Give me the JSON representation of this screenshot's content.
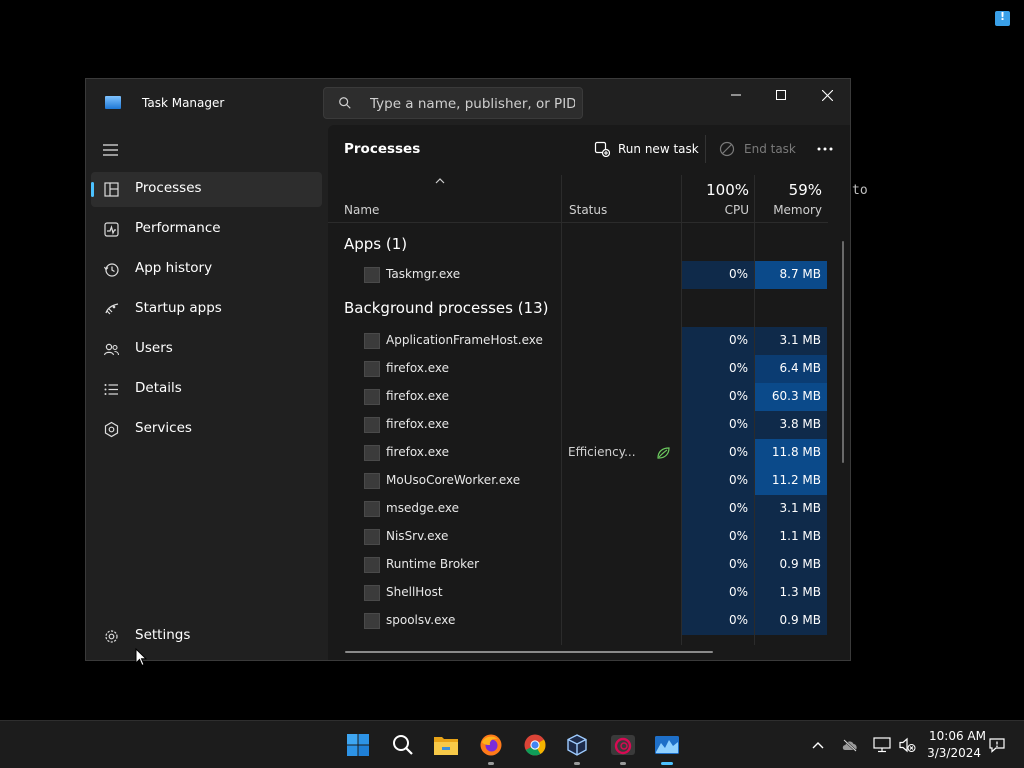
{
  "desktop": {
    "terminal_fragment": "to"
  },
  "window": {
    "title": "Task Manager",
    "search_placeholder": "Type a name, publisher, or PID..."
  },
  "sidebar": {
    "items": [
      {
        "label": "Processes",
        "icon": "processes-icon",
        "active": true
      },
      {
        "label": "Performance",
        "icon": "performance-icon"
      },
      {
        "label": "App history",
        "icon": "app-history-icon"
      },
      {
        "label": "Startup apps",
        "icon": "startup-apps-icon"
      },
      {
        "label": "Users",
        "icon": "users-icon"
      },
      {
        "label": "Details",
        "icon": "details-icon"
      },
      {
        "label": "Services",
        "icon": "services-icon"
      }
    ],
    "settings_label": "Settings"
  },
  "toolbar": {
    "page_title": "Processes",
    "run_new_task": "Run new task",
    "end_task": "End task"
  },
  "table": {
    "columns": {
      "name": "Name",
      "status": "Status",
      "cpu_total": "100%",
      "cpu": "CPU",
      "memory_total": "59%",
      "memory": "Memory"
    },
    "apps_group": "Apps (1)",
    "apps": [
      {
        "name": "Taskmgr.exe",
        "status": "",
        "cpu": "0%",
        "memory": "8.7 MB",
        "mem_color": "#0b4a8a"
      }
    ],
    "background_group": "Background processes (13)",
    "background": [
      {
        "name": "ApplicationFrameHost.exe",
        "status": "",
        "cpu": "0%",
        "memory": "3.1 MB",
        "mem_color": "#0f2a4a"
      },
      {
        "name": "firefox.exe",
        "status": "",
        "cpu": "0%",
        "memory": "6.4 MB",
        "mem_color": "#0b3c72"
      },
      {
        "name": "firefox.exe",
        "status": "",
        "cpu": "0%",
        "memory": "60.3 MB",
        "mem_color": "#0b4a8a"
      },
      {
        "name": "firefox.exe",
        "status": "",
        "cpu": "0%",
        "memory": "3.8 MB",
        "mem_color": "#0f2a4a"
      },
      {
        "name": "firefox.exe",
        "status": "Efficiency...",
        "cpu": "0%",
        "memory": "11.8 MB",
        "mem_color": "#0b4a8a",
        "efficiency": true
      },
      {
        "name": "MoUsoCoreWorker.exe",
        "status": "",
        "cpu": "0%",
        "memory": "11.2 MB",
        "mem_color": "#0b4a8a"
      },
      {
        "name": "msedge.exe",
        "status": "",
        "cpu": "0%",
        "memory": "3.1 MB",
        "mem_color": "#0f2a4a"
      },
      {
        "name": "NisSrv.exe",
        "status": "",
        "cpu": "0%",
        "memory": "1.1 MB",
        "mem_color": "#0f2a4a"
      },
      {
        "name": "Runtime Broker",
        "status": "",
        "cpu": "0%",
        "memory": "0.9 MB",
        "mem_color": "#0f2a4a"
      },
      {
        "name": "ShellHost",
        "status": "",
        "cpu": "0%",
        "memory": "1.3 MB",
        "mem_color": "#0f2a4a"
      },
      {
        "name": "spoolsv.exe",
        "status": "",
        "cpu": "0%",
        "memory": "0.9 MB",
        "mem_color": "#0f2a4a"
      }
    ]
  },
  "taskbar": {
    "apps": [
      "windows-start-icon",
      "search-icon",
      "file-explorer-icon",
      "firefox-icon",
      "chrome-icon",
      "virtualbox-icon",
      "debian-terminal-icon",
      "task-manager-icon"
    ],
    "time": "10:06 AM",
    "date": "3/3/2024"
  },
  "colors": {
    "accent": "#4cc2ff",
    "heat_low": "#0f2a4a",
    "heat_high": "#0b4a8a"
  }
}
